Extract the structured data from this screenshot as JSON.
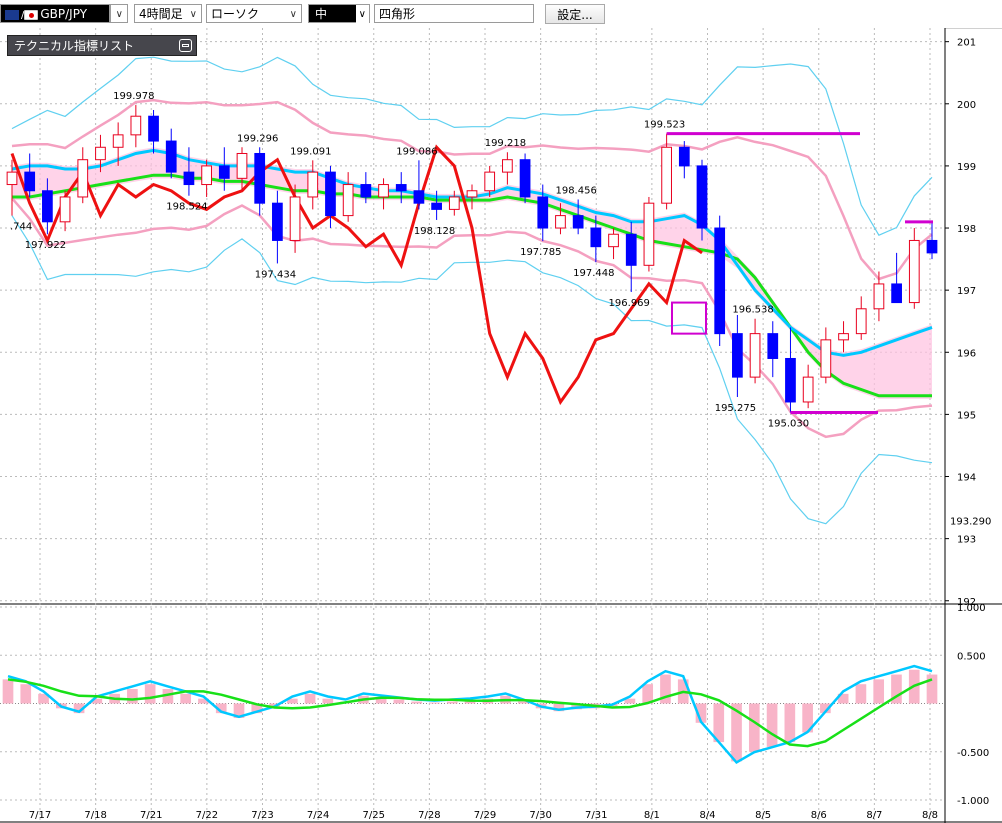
{
  "toolbar": {
    "symbol": "GBP/JPY",
    "timeframe": "4時間足",
    "chart_type": "ローソク",
    "line_width": "中",
    "drawing_tool": "四角形",
    "settings_label": "設定..."
  },
  "panel": {
    "indicator_list_title": "テクニカル指標リスト"
  },
  "colors": {
    "candle_up": "#e8001e",
    "candle_down": "#0000ff",
    "ma_short": "#00c8ff",
    "ma_mid": "#18e018",
    "bb_outer": "#60d0f0",
    "bb_inner": "#f4a0c0",
    "overlay_line": "#ee1111",
    "marker": "#d000d0",
    "cloud": "#ffc0e0"
  },
  "chart_data": [
    {
      "type": "candlestick",
      "y_axis_ticks": [
        "201",
        "200",
        "199",
        "198",
        "197",
        "196",
        "195",
        "194",
        "193",
        "192"
      ],
      "ylim": [
        191.98,
        201.22
      ],
      "current_price_label": "193.290",
      "x_axis_labels": [
        "7/17",
        "7/18",
        "7/21",
        "7/22",
        "7/23",
        "7/24",
        "7/25",
        "7/28",
        "7/29",
        "7/30",
        "7/31",
        "8/1",
        "8/4",
        "8/5",
        "8/6",
        "8/7",
        "8/8"
      ],
      "price_annotations": [
        ".744",
        "199.978",
        "197.922",
        "199.296",
        "198.524",
        "197.434",
        "199.091",
        "199.086",
        "198.128",
        "199.218",
        "197.785",
        "198.456",
        "197.448",
        "196.969",
        "199.523",
        "196.538",
        "195.275",
        "195.030"
      ],
      "candles": [
        {
          "o": 198.7,
          "h": 199.1,
          "l": 198.2,
          "c": 198.9
        },
        {
          "o": 198.9,
          "h": 199.2,
          "l": 198.5,
          "c": 198.6
        },
        {
          "o": 198.6,
          "h": 198.8,
          "l": 197.9,
          "c": 198.1
        },
        {
          "o": 198.1,
          "h": 198.6,
          "l": 197.95,
          "c": 198.5
        },
        {
          "o": 198.5,
          "h": 199.3,
          "l": 198.4,
          "c": 199.1
        },
        {
          "o": 199.1,
          "h": 199.5,
          "l": 198.9,
          "c": 199.3
        },
        {
          "o": 199.3,
          "h": 199.7,
          "l": 199.0,
          "c": 199.5
        },
        {
          "o": 199.5,
          "h": 199.98,
          "l": 199.3,
          "c": 199.8
        },
        {
          "o": 199.8,
          "h": 199.9,
          "l": 199.2,
          "c": 199.4
        },
        {
          "o": 199.4,
          "h": 199.6,
          "l": 198.8,
          "c": 198.9
        },
        {
          "o": 198.9,
          "h": 199.3,
          "l": 198.52,
          "c": 198.7
        },
        {
          "o": 198.7,
          "h": 199.1,
          "l": 198.5,
          "c": 199.0
        },
        {
          "o": 199.0,
          "h": 199.3,
          "l": 198.6,
          "c": 198.8
        },
        {
          "o": 198.8,
          "h": 199.3,
          "l": 198.6,
          "c": 199.2
        },
        {
          "o": 199.2,
          "h": 199.3,
          "l": 198.2,
          "c": 198.4
        },
        {
          "o": 198.4,
          "h": 198.6,
          "l": 197.43,
          "c": 197.8
        },
        {
          "o": 197.8,
          "h": 198.7,
          "l": 197.6,
          "c": 198.5
        },
        {
          "o": 198.5,
          "h": 199.09,
          "l": 198.3,
          "c": 198.9
        },
        {
          "o": 198.9,
          "h": 199.0,
          "l": 198.0,
          "c": 198.2
        },
        {
          "o": 198.2,
          "h": 198.9,
          "l": 198.1,
          "c": 198.7
        },
        {
          "o": 198.7,
          "h": 198.9,
          "l": 198.4,
          "c": 198.5
        },
        {
          "o": 198.5,
          "h": 198.8,
          "l": 198.3,
          "c": 198.7
        },
        {
          "o": 198.7,
          "h": 198.9,
          "l": 198.4,
          "c": 198.6
        },
        {
          "o": 198.6,
          "h": 199.09,
          "l": 198.3,
          "c": 198.4
        },
        {
          "o": 198.4,
          "h": 198.6,
          "l": 198.13,
          "c": 198.3
        },
        {
          "o": 198.3,
          "h": 198.6,
          "l": 198.2,
          "c": 198.5
        },
        {
          "o": 198.5,
          "h": 198.7,
          "l": 198.3,
          "c": 198.6
        },
        {
          "o": 198.6,
          "h": 199.0,
          "l": 198.5,
          "c": 198.9
        },
        {
          "o": 198.9,
          "h": 199.22,
          "l": 198.7,
          "c": 199.1
        },
        {
          "o": 199.1,
          "h": 199.2,
          "l": 198.4,
          "c": 198.5
        },
        {
          "o": 198.5,
          "h": 198.7,
          "l": 197.79,
          "c": 198.0
        },
        {
          "o": 198.0,
          "h": 198.4,
          "l": 197.9,
          "c": 198.2
        },
        {
          "o": 198.2,
          "h": 198.46,
          "l": 197.9,
          "c": 198.0
        },
        {
          "o": 198.0,
          "h": 198.2,
          "l": 197.45,
          "c": 197.7
        },
        {
          "o": 197.7,
          "h": 198.0,
          "l": 197.5,
          "c": 197.9
        },
        {
          "o": 197.9,
          "h": 198.1,
          "l": 196.97,
          "c": 197.4
        },
        {
          "o": 197.4,
          "h": 198.5,
          "l": 197.3,
          "c": 198.4
        },
        {
          "o": 198.4,
          "h": 199.52,
          "l": 198.3,
          "c": 199.3
        },
        {
          "o": 199.3,
          "h": 199.4,
          "l": 198.8,
          "c": 199.0
        },
        {
          "o": 199.0,
          "h": 199.1,
          "l": 197.8,
          "c": 198.0
        },
        {
          "o": 198.0,
          "h": 198.2,
          "l": 196.1,
          "c": 196.3
        },
        {
          "o": 196.3,
          "h": 196.6,
          "l": 195.28,
          "c": 195.6
        },
        {
          "o": 195.6,
          "h": 196.54,
          "l": 195.5,
          "c": 196.3
        },
        {
          "o": 196.3,
          "h": 196.5,
          "l": 195.6,
          "c": 195.9
        },
        {
          "o": 195.9,
          "h": 196.4,
          "l": 195.03,
          "c": 195.2
        },
        {
          "o": 195.2,
          "h": 195.8,
          "l": 195.1,
          "c": 195.6
        },
        {
          "o": 195.6,
          "h": 196.4,
          "l": 195.5,
          "c": 196.2
        },
        {
          "o": 196.2,
          "h": 196.5,
          "l": 196.0,
          "c": 196.3
        },
        {
          "o": 196.3,
          "h": 196.9,
          "l": 196.2,
          "c": 196.7
        },
        {
          "o": 196.7,
          "h": 197.3,
          "l": 196.5,
          "c": 197.1
        },
        {
          "o": 197.1,
          "h": 197.6,
          "l": 196.9,
          "c": 196.8
        },
        {
          "o": 196.8,
          "h": 198.0,
          "l": 196.7,
          "c": 197.8
        },
        {
          "o": 197.8,
          "h": 198.1,
          "l": 197.5,
          "c": 197.6
        }
      ],
      "series": [
        {
          "name": "",
          "values": [
            198.95,
            199.0,
            199.0,
            198.95,
            198.95,
            199.0,
            199.1,
            199.2,
            199.25,
            199.2,
            199.1,
            199.05,
            199.0,
            199.0,
            199.0,
            198.95,
            198.9,
            198.9,
            198.8,
            198.7,
            198.65,
            198.6,
            198.6,
            198.55,
            198.5,
            198.5,
            198.5,
            198.55,
            198.65,
            198.6,
            198.55,
            198.45,
            198.35,
            198.25,
            198.2,
            198.1,
            198.1,
            198.15,
            198.2,
            198.05,
            197.8,
            197.4,
            197.0,
            196.7,
            196.4,
            196.2,
            196.0,
            195.95,
            196.0,
            196.1,
            196.2,
            196.3,
            196.4
          ]
        },
        {
          "name": "",
          "values": [
            198.5,
            198.5,
            198.55,
            198.6,
            198.65,
            198.7,
            198.75,
            198.8,
            198.85,
            198.85,
            198.8,
            198.8,
            198.75,
            198.75,
            198.7,
            198.65,
            198.6,
            198.6,
            198.55,
            198.55,
            198.5,
            198.5,
            198.5,
            198.5,
            198.45,
            198.45,
            198.45,
            198.45,
            198.5,
            198.45,
            198.4,
            198.3,
            198.2,
            198.1,
            198.0,
            197.9,
            197.8,
            197.75,
            197.7,
            197.65,
            197.6,
            197.5,
            197.2,
            196.8,
            196.4,
            196.0,
            195.7,
            195.5,
            195.4,
            195.3,
            195.3,
            195.3,
            195.3
          ]
        }
      ]
    },
    {
      "type": "bar",
      "y_axis_ticks": [
        "1.000",
        "0.500",
        "-0.500",
        "-1.000"
      ],
      "ylim": [
        -1.0,
        1.0
      ],
      "values": [
        0.25,
        0.2,
        0.1,
        -0.05,
        -0.1,
        0.05,
        0.1,
        0.15,
        0.2,
        0.15,
        0.1,
        0.05,
        -0.1,
        -0.15,
        -0.1,
        -0.05,
        0.05,
        0.1,
        0.05,
        0.02,
        0.08,
        0.06,
        0.04,
        0.02,
        0.01,
        0.02,
        0.03,
        0.05,
        0.08,
        0.02,
        -0.05,
        -0.08,
        -0.06,
        -0.05,
        -0.03,
        0.05,
        0.2,
        0.3,
        0.25,
        -0.2,
        -0.4,
        -0.6,
        -0.5,
        -0.45,
        -0.4,
        -0.3,
        -0.1,
        0.1,
        0.2,
        0.25,
        0.3,
        0.35,
        0.3
      ]
    }
  ]
}
